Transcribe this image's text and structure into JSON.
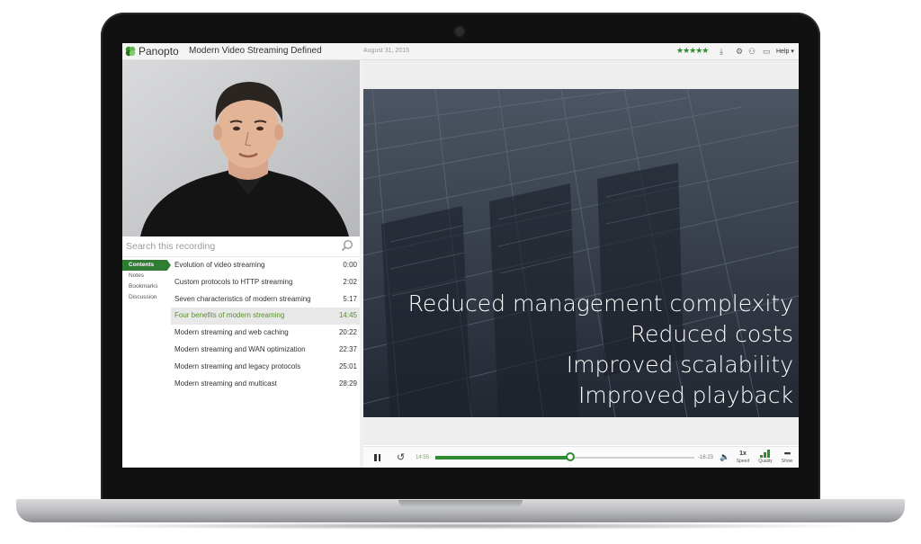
{
  "header": {
    "brand": "Panopto",
    "recording_title": "Modern Video Streaming Defined",
    "date": "August 31, 2015",
    "rating_stars": "★★★★★",
    "help_label": "Help ▾",
    "icons": [
      "download-icon",
      "settings-icon",
      "share-icon",
      "fullscreen-icon"
    ]
  },
  "search": {
    "placeholder": "Search this recording"
  },
  "side_tabs": [
    "Contents",
    "Notes",
    "Bookmarks",
    "Discussion"
  ],
  "contents": [
    {
      "title": "Evolution of video streaming",
      "time": "0:00"
    },
    {
      "title": "Custom protocols to HTTP streaming",
      "time": "2:02"
    },
    {
      "title": "Seven characteristics of modern streaming",
      "time": "5:17"
    },
    {
      "title": "Four benefits of modern streaming",
      "time": "14:45",
      "active": true
    },
    {
      "title": "Modern streaming and web caching",
      "time": "20:22"
    },
    {
      "title": "Modern streaming and WAN optimization",
      "time": "22:37"
    },
    {
      "title": "Modern streaming and legacy protocols",
      "time": "25:01"
    },
    {
      "title": "Modern streaming and multicast",
      "time": "28:29"
    }
  ],
  "slide": {
    "lines": [
      "Reduced management complexity",
      "Reduced costs",
      "Improved scalability",
      "Improved playback"
    ]
  },
  "player": {
    "elapsed": "14:55",
    "remaining": "-16:23",
    "progress_fraction": 0.52,
    "speed_value": "1x",
    "speed_label": "Speed",
    "quality_label": "Quality",
    "show_label": "Show"
  },
  "colors": {
    "accent": "#2e8b2e",
    "active_tab": "#2e7d32",
    "slide_bg": "#2d3440"
  }
}
